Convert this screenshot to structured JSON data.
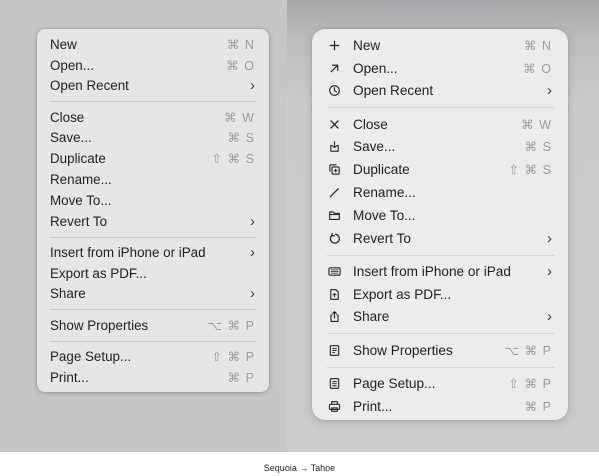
{
  "sequoia_menu": {
    "items": [
      {
        "label": "New",
        "shortcut": "⌘ N"
      },
      {
        "label": "Open...",
        "shortcut": "⌘ O"
      },
      {
        "label": "Open Recent",
        "submenu": "›"
      },
      {
        "label": "Close",
        "shortcut": "⌘ W"
      },
      {
        "label": "Save...",
        "shortcut": "⌘ S"
      },
      {
        "label": "Duplicate",
        "shortcut": "⇧ ⌘ S"
      },
      {
        "label": "Rename..."
      },
      {
        "label": "Move To..."
      },
      {
        "label": "Revert To",
        "submenu": "›"
      },
      {
        "label": "Insert from iPhone or iPad",
        "submenu": "›"
      },
      {
        "label": "Export as PDF..."
      },
      {
        "label": "Share",
        "submenu": "›"
      },
      {
        "label": "Show Properties",
        "shortcut": "⌥ ⌘ P"
      },
      {
        "label": "Page Setup...",
        "shortcut": "⇧ ⌘ P"
      },
      {
        "label": "Print...",
        "shortcut": "⌘ P"
      }
    ]
  },
  "tahoe_menu": {
    "items": [
      {
        "label": "New",
        "shortcut": "⌘ N",
        "icon": "plus-icon"
      },
      {
        "label": "Open...",
        "shortcut": "⌘ O",
        "icon": "arrow-up-right-icon"
      },
      {
        "label": "Open Recent",
        "submenu": "›",
        "icon": "clock-icon"
      },
      {
        "label": "Close",
        "shortcut": "⌘ W",
        "icon": "close-icon"
      },
      {
        "label": "Save...",
        "shortcut": "⌘ S",
        "icon": "save-icon"
      },
      {
        "label": "Duplicate",
        "shortcut": "⇧ ⌘ S",
        "icon": "duplicate-icon"
      },
      {
        "label": "Rename...",
        "icon": "pencil-icon"
      },
      {
        "label": "Move To...",
        "icon": "folder-icon"
      },
      {
        "label": "Revert To",
        "submenu": "›",
        "icon": "revert-icon"
      },
      {
        "label": "Insert from iPhone or iPad",
        "submenu": "›",
        "icon": "device-icon"
      },
      {
        "label": "Export as PDF...",
        "icon": "document-icon"
      },
      {
        "label": "Share",
        "submenu": "›",
        "icon": "share-icon"
      },
      {
        "label": "Show Properties",
        "shortcut": "⌥ ⌘ P",
        "icon": "properties-icon"
      },
      {
        "label": "Page Setup...",
        "shortcut": "⇧ ⌘ P",
        "icon": "page-setup-icon"
      },
      {
        "label": "Print...",
        "shortcut": "⌘ P",
        "icon": "printer-icon"
      }
    ]
  },
  "caption": "Sequoia → Tahoe"
}
